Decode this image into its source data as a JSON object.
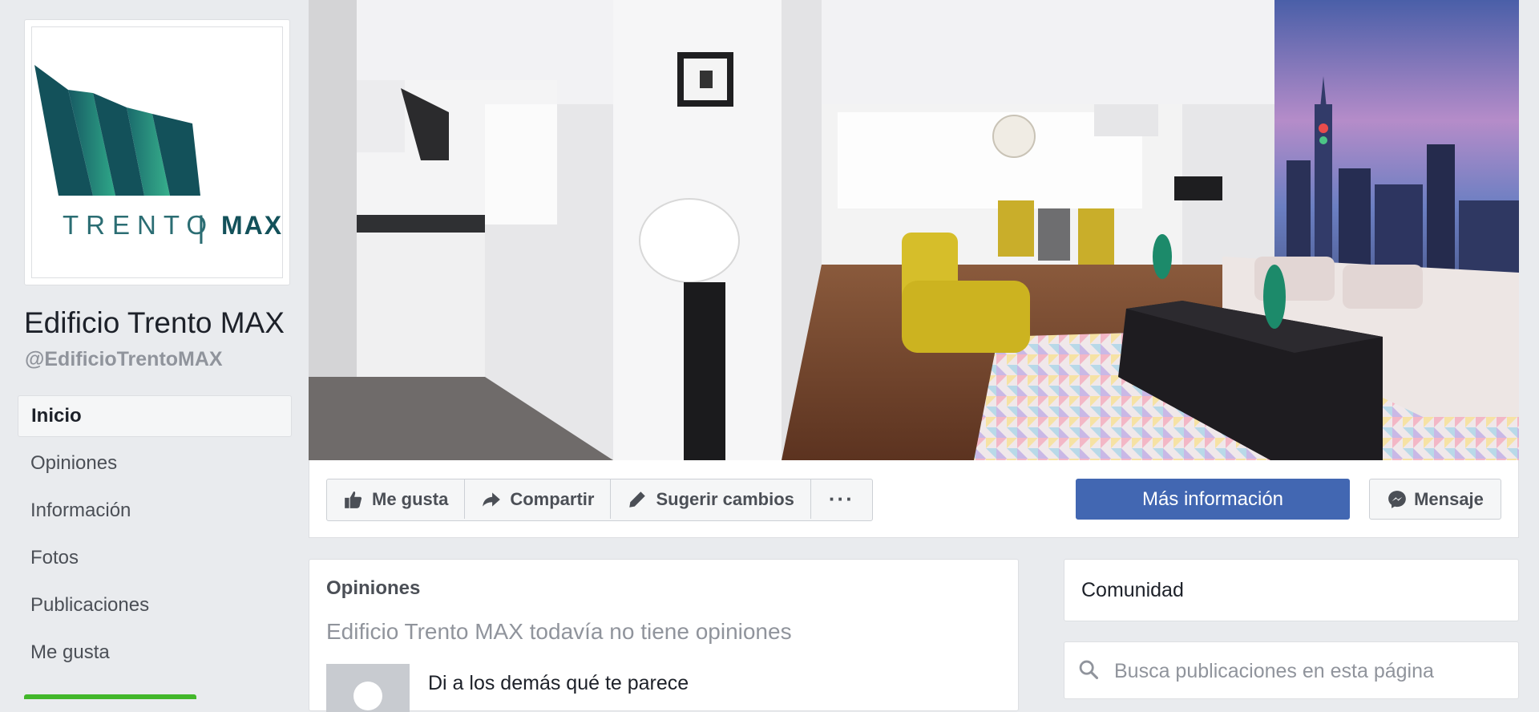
{
  "page": {
    "name": "Edificio Trento MAX",
    "handle": "@EdificioTrentoMAX"
  },
  "logo": {
    "word_left": "TRENTO",
    "divider": "|",
    "word_right": "MAX"
  },
  "sidebar": {
    "items": [
      {
        "label": "Inicio",
        "active": true
      },
      {
        "label": "Opiniones",
        "active": false
      },
      {
        "label": "Información",
        "active": false
      },
      {
        "label": "Fotos",
        "active": false
      },
      {
        "label": "Publicaciones",
        "active": false
      },
      {
        "label": "Me gusta",
        "active": false
      }
    ]
  },
  "actions": {
    "like": {
      "label": "Me gusta",
      "icon": "thumbs-up-icon"
    },
    "share": {
      "label": "Compartir",
      "icon": "share-arrow-icon"
    },
    "suggest": {
      "label": "Sugerir cambios",
      "icon": "pencil-icon"
    },
    "more": {
      "label": "···",
      "icon": "more-dots-icon"
    },
    "info": {
      "label": "Más información"
    },
    "message": {
      "label": "Mensaje",
      "icon": "messenger-icon"
    }
  },
  "reviews": {
    "title": "Opiniones",
    "empty_text": "Edificio Trento MAX todavía no tiene opiniones",
    "prompt": "Di a los demás qué te parece"
  },
  "community": {
    "title": "Comunidad"
  },
  "search": {
    "placeholder": "Busca publicaciones en esta página",
    "icon": "search-icon"
  },
  "colors": {
    "background": "#e9ebee",
    "primary_button": "#4267b2",
    "logo_teal": "#13515a",
    "logo_green": "#2aa58a",
    "secondary_text": "#90949c"
  }
}
